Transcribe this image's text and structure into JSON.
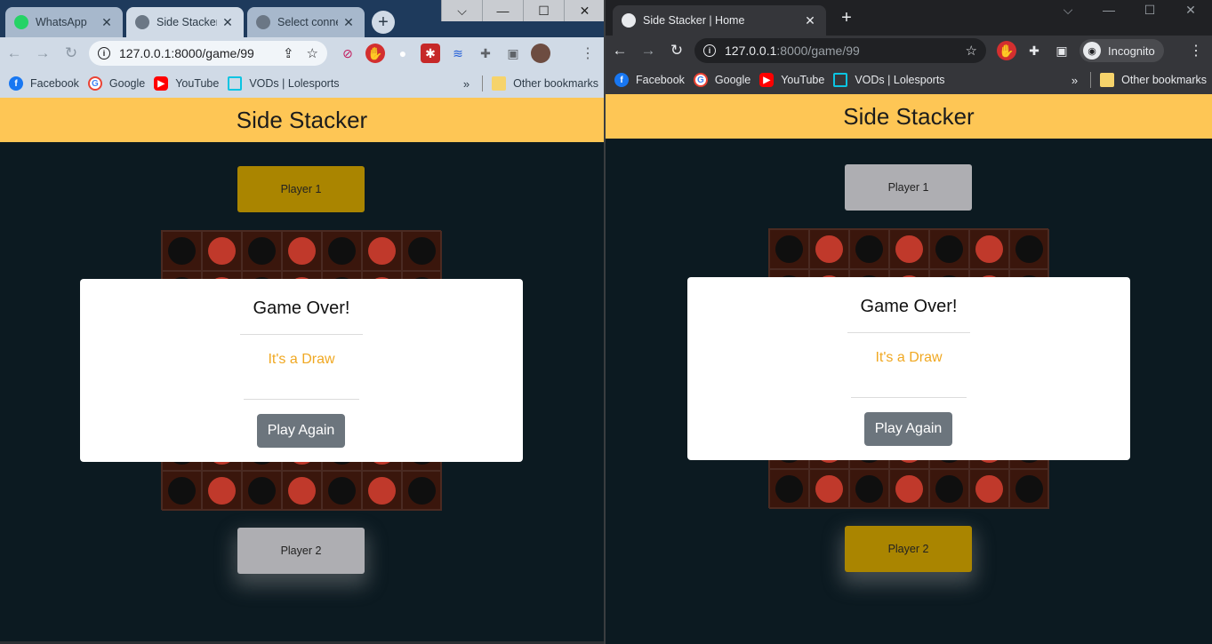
{
  "left": {
    "tabs": [
      {
        "label": "WhatsApp"
      },
      {
        "label": "Side Stacker | Home"
      },
      {
        "label": "Select connect"
      }
    ],
    "url": {
      "host": "127.0.0.1:8000/game/99",
      "path": ""
    },
    "bookmarks": [
      {
        "label": "Facebook",
        "icon": "facebook-icon"
      },
      {
        "label": "Google",
        "icon": "google-icon"
      },
      {
        "label": "YouTube",
        "icon": "youtube-icon"
      },
      {
        "label": "VODs | Lolesports",
        "icon": "lolesports-icon"
      }
    ],
    "other_bookmarks": "Other bookmarks"
  },
  "right": {
    "tab": {
      "label": "Side Stacker | Home"
    },
    "url": {
      "host": "127.0.0.1",
      "path": ":8000/game/99"
    },
    "incognito_label": "Incognito",
    "bookmarks": [
      {
        "label": "Facebook",
        "icon": "facebook-icon"
      },
      {
        "label": "Google",
        "icon": "google-icon"
      },
      {
        "label": "YouTube",
        "icon": "youtube-icon"
      },
      {
        "label": "VODs | Lolesports",
        "icon": "lolesports-icon"
      }
    ],
    "other_bookmarks": "Other bookmarks"
  },
  "game": {
    "title": "Side Stacker",
    "player1_label": "Player 1",
    "player2_label": "Player 2",
    "modal": {
      "title": "Game Over!",
      "message": "It's a Draw",
      "button": "Play Again"
    },
    "board_rows": [
      [
        "k",
        "r",
        "k",
        "r",
        "k",
        "r",
        "k"
      ],
      [
        "k",
        "r",
        "k",
        "r",
        "k",
        "r",
        "k"
      ],
      [
        "k",
        "r",
        "k",
        "r",
        "k",
        "r",
        "k"
      ],
      [
        "k",
        "r",
        "k",
        "r",
        "k",
        "r",
        "k"
      ],
      [
        "k",
        "r",
        "k",
        "r",
        "k",
        "r",
        "k"
      ],
      [
        "k",
        "r",
        "k",
        "r",
        "k",
        "r",
        "k"
      ],
      [
        "k",
        "r",
        "k",
        "r",
        "k",
        "r",
        "k"
      ]
    ],
    "left_active_player": "player1",
    "right_active_player": "player2"
  },
  "colors": {
    "header": "#fec655",
    "active_player": "#aa8500",
    "idle_player": "#aeaeb2",
    "red_disc": "#c0392b",
    "black_disc": "#0f0f0f",
    "draw_text": "#f0a822",
    "page_bg": "#0c1a21"
  }
}
